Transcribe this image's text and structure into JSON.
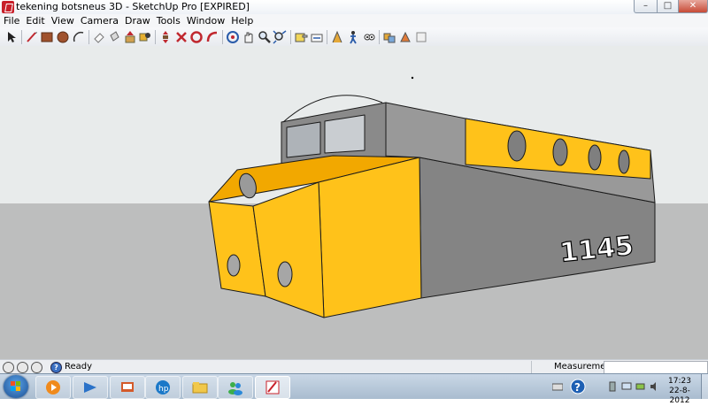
{
  "window": {
    "title": "tekening botsneus 3D - SketchUp Pro [EXPIRED]",
    "min_glyph": "–",
    "max_glyph": "□",
    "close_glyph": "✕"
  },
  "menu": [
    "File",
    "Edit",
    "View",
    "Camera",
    "Draw",
    "Tools",
    "Window",
    "Help"
  ],
  "toolbar_icons": [
    "select",
    "line",
    "rectangle",
    "circle",
    "arc",
    "eraser",
    "paint-bucket",
    "push-pull",
    "move",
    "rotate",
    "follow-me",
    "offset",
    "orbit",
    "pan",
    "zoom",
    "zoom-extents",
    "previous-view",
    "tape-measure",
    "dimension",
    "protractor",
    "text",
    "axes",
    "3d-text",
    "section-plane",
    "walk",
    "look-around",
    "position-camera"
  ],
  "model": {
    "number_label": "1145",
    "colors": {
      "yellow": "#ffc21a",
      "yellow_dark": "#f5a800",
      "gray": "#848484",
      "gray_top": "#9a9a9a",
      "sky": "#e7eaea",
      "ground": "#bfc0c0"
    }
  },
  "status": {
    "ready": "Ready",
    "measurements_label": "Measurements",
    "measurements_value": ""
  },
  "taskbar": {
    "apps": [
      "windows-media-player",
      "windows-explorer",
      "hp-solution-center",
      "file-explorer",
      "windows-live-messenger",
      "sketchup"
    ],
    "clock_time": "17:23",
    "clock_date": "22-8-2012"
  }
}
